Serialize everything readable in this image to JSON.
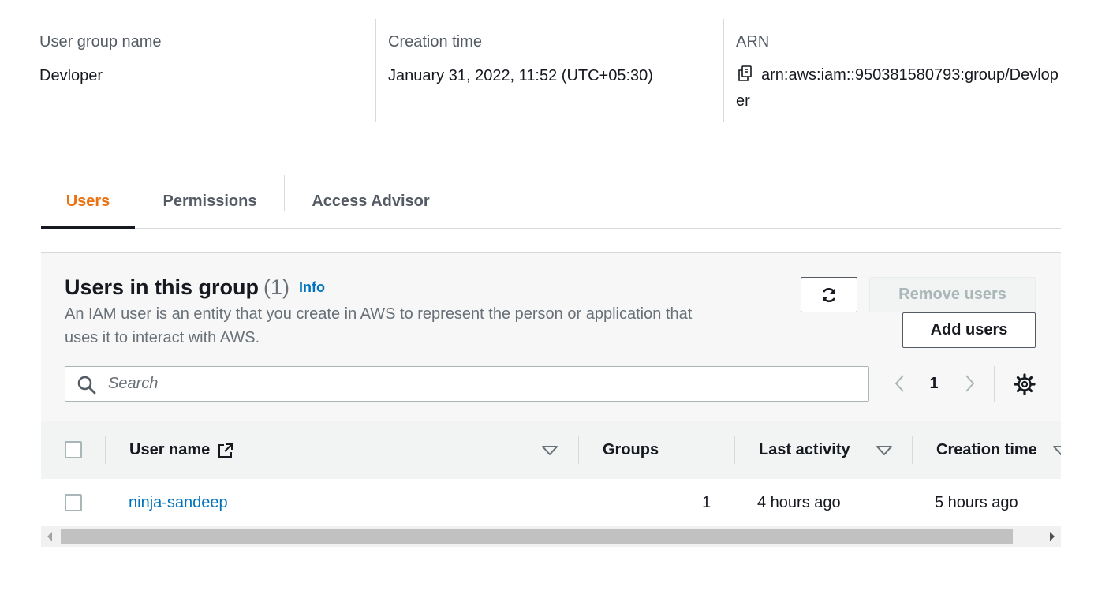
{
  "summary": {
    "group_name_label": "User group name",
    "group_name_value": "Devloper",
    "creation_time_label": "Creation time",
    "creation_time_value": "January 31, 2022, 11:52 (UTC+05:30)",
    "arn_label": "ARN",
    "arn_value": "arn:aws:iam::950381580793:group/Devloper"
  },
  "tabs": [
    {
      "label": "Users",
      "active": true
    },
    {
      "label": "Permissions",
      "active": false
    },
    {
      "label": "Access Advisor",
      "active": false
    }
  ],
  "panel": {
    "title": "Users in this group",
    "count": "(1)",
    "info_label": "Info",
    "description": "An IAM user is an entity that you create in AWS to represent the person or application that uses it to interact with AWS.",
    "remove_label": "Remove users",
    "add_label": "Add users",
    "search_placeholder": "Search",
    "current_page": "1"
  },
  "table": {
    "columns": [
      "User name",
      "Groups",
      "Last activity",
      "Creation time"
    ],
    "rows": [
      {
        "user_name": "ninja-sandeep",
        "groups": "1",
        "last_activity": "4 hours ago",
        "creation_time": "5 hours ago"
      }
    ]
  },
  "icons": [
    "copy-icon",
    "refresh-icon",
    "search-icon",
    "chevron-left-icon",
    "chevron-right-icon",
    "gear-icon",
    "external-link-icon",
    "sort-down-icon"
  ],
  "colors": {
    "accent": "#ec7211",
    "link": "#0073bb",
    "text": "#16191f",
    "muted": "#687078"
  }
}
